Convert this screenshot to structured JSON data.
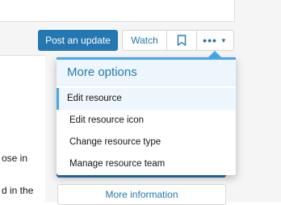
{
  "toolbar": {
    "post_update_label": "Post an update",
    "watch_label": "Watch",
    "bookmark_icon": "bookmark-icon",
    "more_label": "•••",
    "more_caret": "▼"
  },
  "background_text": {
    "line1": "ose in",
    "line2": "d in the"
  },
  "dropdown": {
    "title": "More options",
    "items": [
      {
        "label": "Edit resource"
      },
      {
        "label": "Edit resource icon"
      },
      {
        "label": "Change resource type"
      },
      {
        "label": "Manage resource team"
      }
    ],
    "selected_index": 0
  },
  "sidebar": {
    "more_information_label": "More information"
  },
  "colors": {
    "accent": "#2577b1",
    "menu_border": "#47a7eb",
    "menu_header_bg": "#edf6fd"
  }
}
